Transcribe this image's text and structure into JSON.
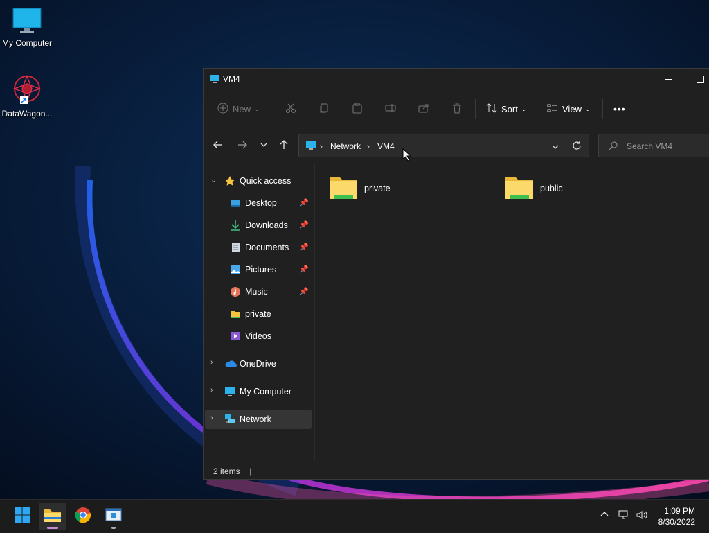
{
  "desktop": {
    "icons": [
      {
        "label": "My Computer"
      },
      {
        "label": "DataWagon..."
      }
    ]
  },
  "window": {
    "title": "VM4",
    "toolbar": {
      "new_label": "New",
      "sort_label": "Sort",
      "view_label": "View",
      "more_label": "•••"
    },
    "address": {
      "crumbs": [
        "Network",
        "VM4"
      ]
    },
    "search": {
      "placeholder": "Search VM4"
    },
    "sidebar": {
      "quick_access": "Quick access",
      "items": [
        {
          "label": "Desktop",
          "pinned": true
        },
        {
          "label": "Downloads",
          "pinned": true
        },
        {
          "label": "Documents",
          "pinned": true
        },
        {
          "label": "Pictures",
          "pinned": true
        },
        {
          "label": "Music",
          "pinned": true
        },
        {
          "label": "private",
          "pinned": false
        },
        {
          "label": "Videos",
          "pinned": false
        }
      ],
      "onedrive": "OneDrive",
      "my_computer": "My Computer",
      "network": "Network"
    },
    "files": [
      {
        "name": "private"
      },
      {
        "name": "public"
      }
    ],
    "status": {
      "item_count": "2 items"
    }
  },
  "taskbar": {
    "time": "1:09 PM",
    "date": "8/30/2022"
  },
  "colors": {
    "accent": "#4cc2ff",
    "folder": "#f5c542",
    "window_bg": "#202020",
    "taskbar_bg": "#1c1c1c"
  }
}
